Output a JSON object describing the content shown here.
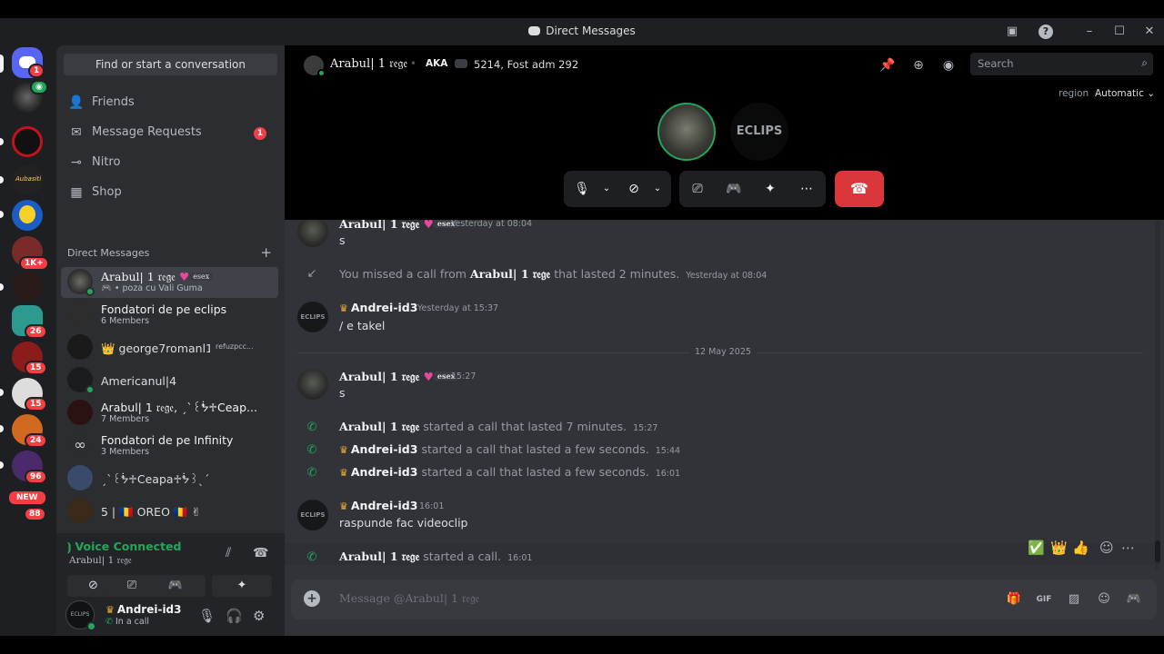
{
  "window": {
    "title": "Direct Messages"
  },
  "rail": {
    "badges": {
      "home": "1",
      "s_1k": "1K+",
      "s_26": "26",
      "s_15a": "15",
      "s_15b": "15",
      "s_24": "24",
      "s_96": "96",
      "new": "NEW",
      "s_88": "88"
    }
  },
  "sidebar": {
    "find": "Find or start a conversation",
    "nav": [
      {
        "label": "Friends",
        "icon": "friends-icon"
      },
      {
        "label": "Message Requests",
        "icon": "mail-icon",
        "badge": "1"
      },
      {
        "label": "Nitro",
        "icon": "nitro-icon"
      },
      {
        "label": "Shop",
        "icon": "shop-icon"
      }
    ],
    "dm_header": "Direct Messages",
    "dms": [
      {
        "name": "Arabul| 1 𝔯𝔢𝔤𝔢",
        "tag": "esex",
        "sub": "🎮 • poza cu Vali Guma"
      },
      {
        "name": "Fondatori de pe eclips",
        "sub": "6 Members"
      },
      {
        "name": "👑 george7romanl104 👑",
        "tag": "refuzpcc..."
      },
      {
        "name": "Americanul|4"
      },
      {
        "name": "Arabul| 1 𝔯𝔢𝔤𝔢, ˏˋ꒰ᖭ♱Ceap...",
        "sub": "7 Members"
      },
      {
        "name": "Fondatori de pe Infinity",
        "sub": "3 Members"
      },
      {
        "name": "ˏˋ꒰ᖭ♱Ceapa♱ᖭ꒱ˎˊ"
      },
      {
        "name": "5 | 🇷🇴 OREO 🇷🇴 ✌"
      }
    ],
    "voice": {
      "status": "Voice Connected",
      "channel": "Arabul| 1 𝔯𝔢𝔤𝔢"
    },
    "user": {
      "name": "Andrei-id3",
      "status": "In a call"
    }
  },
  "header": {
    "name": "Arabul| 1 𝔯𝔢𝔤𝔢",
    "aka": "AKA",
    "aka_value": "5214, Fost adm 292",
    "search_placeholder": "Search",
    "region_label": "region",
    "region_value": "Automatic"
  },
  "call": {
    "eclips_label": "ECLIPS"
  },
  "messages": {
    "m1": {
      "author": "Arabul| 1 𝔯𝔢𝔤𝔢",
      "tag": "esex",
      "time": "Yesterday at 08:04",
      "text": "s"
    },
    "missed": {
      "pre": "You missed a call from",
      "author": "Arabul| 1 𝔯𝔢𝔤𝔢",
      "post": "that lasted 2 minutes.",
      "time": "Yesterday at 08:04"
    },
    "m2": {
      "author": "Andrei-id3",
      "time": "Yesterday at 15:37",
      "text": "/ e takel"
    },
    "date_divider": "12 May 2025",
    "m3": {
      "author": "Arabul| 1 𝔯𝔢𝔤𝔢",
      "tag": "esex",
      "time": "15:27",
      "text": "s"
    },
    "c1": {
      "author": "Arabul| 1 𝔯𝔢𝔤𝔢",
      "text": "started a call that lasted 7 minutes.",
      "time": "15:27"
    },
    "c2": {
      "author": "Andrei-id3",
      "text": "started a call that lasted a few seconds.",
      "time": "15:44"
    },
    "c3": {
      "author": "Andrei-id3",
      "text": "started a call that lasted a few seconds.",
      "time": "16:01"
    },
    "m4": {
      "author": "Andrei-id3",
      "time": "16:01",
      "text": "raspunde fac videoclip"
    },
    "c4": {
      "author": "Arabul| 1 𝔯𝔢𝔤𝔢",
      "text": "started a call.",
      "time": "16:01"
    },
    "avatar_label": "ECLIPS"
  },
  "composer": {
    "placeholder": "Message @Arabul| 1 𝔯𝔢𝔤𝔢"
  },
  "colors": {
    "accent": "#23a55a",
    "danger": "#da373c",
    "bg": "#313338"
  }
}
